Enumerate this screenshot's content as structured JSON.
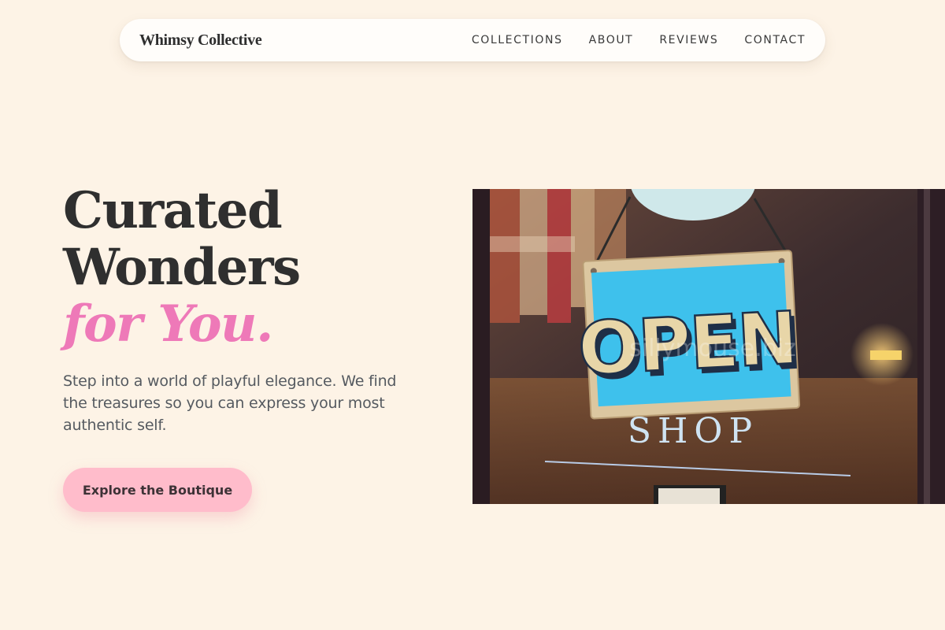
{
  "nav": {
    "brand": "Whimsy Collective",
    "links": [
      "COLLECTIONS",
      "ABOUT",
      "REVIEWS",
      "CONTACT"
    ]
  },
  "hero": {
    "title_line1": "Curated",
    "title_line2": "Wonders",
    "title_accent": "for You.",
    "subtitle": "Step into a world of playful elegance. We find the treasures so you can express your most authentic self.",
    "cta_label": "Explore the Boutique"
  },
  "image": {
    "sign_text": "OPEN",
    "shop_text": "SHOP",
    "watermark": "sillymouse.biz"
  },
  "colors": {
    "background": "#fdf3e6",
    "accent_pink": "#ee79b8",
    "cta_pink": "#ffbccb",
    "sign_blue": "#3ec1ec"
  }
}
